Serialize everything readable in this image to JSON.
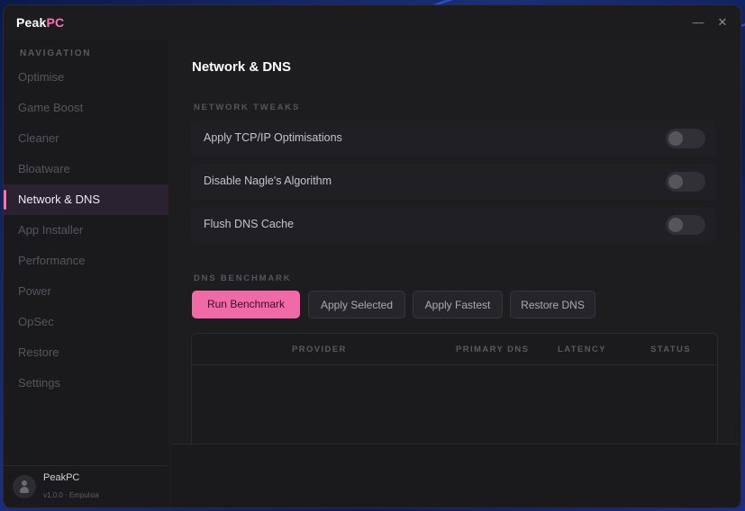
{
  "app": {
    "title_main": "Peak",
    "title_accent": "PC",
    "accent_color": "#ff6fb5"
  },
  "window_controls": {
    "minimize_icon": "minimize-icon",
    "close_icon": "close-icon"
  },
  "sidebar": {
    "heading": "NAVIGATION",
    "items": [
      {
        "label": "Optimise",
        "active": false
      },
      {
        "label": "Game Boost",
        "active": false
      },
      {
        "label": "Cleaner",
        "active": false
      },
      {
        "label": "Bloatware",
        "active": false
      },
      {
        "label": "Network & DNS",
        "active": true
      },
      {
        "label": "App Installer",
        "active": false
      },
      {
        "label": "Performance",
        "active": false
      },
      {
        "label": "Power",
        "active": false
      },
      {
        "label": "OpSec",
        "active": false
      },
      {
        "label": "Restore",
        "active": false
      },
      {
        "label": "Settings",
        "active": false
      }
    ],
    "footer": {
      "name": "PeakPC",
      "version": "v1.0.0 · Empulsia",
      "avatar_icon": "user-avatar-icon"
    }
  },
  "main": {
    "title": "Network & DNS",
    "network_tweaks": {
      "heading": "NETWORK TWEAKS",
      "items": [
        {
          "label": "Apply TCP/IP Optimisations",
          "enabled": false
        },
        {
          "label": "Disable Nagle's Algorithm",
          "enabled": false
        },
        {
          "label": "Flush DNS Cache",
          "enabled": false
        }
      ]
    },
    "dns_benchmark": {
      "heading": "DNS BENCHMARK",
      "buttons": {
        "run": "Run Benchmark",
        "apply_selected": "Apply Selected",
        "apply_fastest": "Apply Fastest",
        "restore": "Restore DNS"
      },
      "table": {
        "columns": {
          "provider": "PROVIDER",
          "primary": "PRIMARY DNS",
          "latency": "LATENCY",
          "status": "STATUS"
        },
        "rows": []
      }
    }
  }
}
